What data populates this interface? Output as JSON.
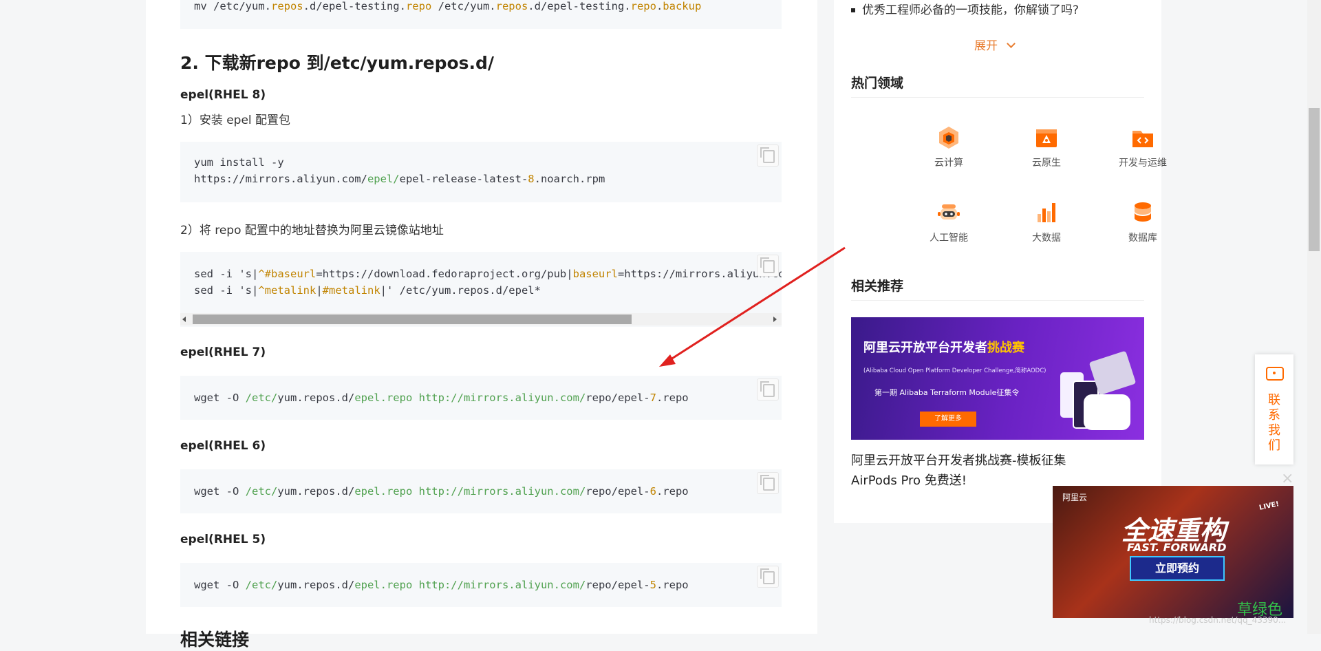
{
  "article": {
    "top_code": {
      "parts": [
        {
          "t": "mv /etc/yum.",
          "c": "c-gray"
        },
        {
          "t": "repos",
          "c": "c-orange"
        },
        {
          "t": ".d/epel-testing.",
          "c": "c-gray"
        },
        {
          "t": "repo",
          "c": "c-orange"
        },
        {
          "t": " /etc/yum.",
          "c": "c-gray"
        },
        {
          "t": "repos",
          "c": "c-orange"
        },
        {
          "t": ".d/epel-testing.",
          "c": "c-gray"
        },
        {
          "t": "repo",
          "c": "c-orange"
        },
        {
          "t": ".",
          "c": "c-gray"
        },
        {
          "t": "backup",
          "c": "c-orange"
        }
      ]
    },
    "section_heading": "2. 下载新repo 到/etc/yum.repos.d/",
    "rhel8": {
      "label": "epel(RHEL 8)",
      "step1": "1）安装 epel 配置包",
      "code_line1": "yum install -y",
      "code_line2_parts": [
        {
          "t": "https://",
          "c": "c-gray"
        },
        {
          "t": "mirrors.aliyun.com/",
          "c": "c-gray"
        },
        {
          "t": "epel/",
          "c": "c-green"
        },
        {
          "t": "epel-release-latest-",
          "c": "c-gray"
        },
        {
          "t": "8",
          "c": "c-orange"
        },
        {
          "t": ".noarch.rpm",
          "c": "c-gray"
        }
      ],
      "step2": "2）将 repo 配置中的地址替换为阿里云镜像站地址",
      "sed_line1_parts": [
        {
          "t": "sed -i 's|",
          "c": "c-gray"
        },
        {
          "t": "^#baseurl",
          "c": "c-orange"
        },
        {
          "t": "=https://download.fedoraproject.org/pub|",
          "c": "c-gray"
        },
        {
          "t": "baseurl",
          "c": "c-orange"
        },
        {
          "t": "=https://mirrors.aliyun.co",
          "c": "c-gray"
        }
      ],
      "sed_line2_parts": [
        {
          "t": "sed -i 's|",
          "c": "c-gray"
        },
        {
          "t": "^metalink",
          "c": "c-orange"
        },
        {
          "t": "|",
          "c": "c-gray"
        },
        {
          "t": "#metalink",
          "c": "c-orange"
        },
        {
          "t": "|' /etc/yum.repos.d/epel*",
          "c": "c-gray"
        }
      ]
    },
    "rhel7": {
      "label": "epel(RHEL 7)",
      "code_parts": [
        {
          "t": "wget -O ",
          "c": "c-gray"
        },
        {
          "t": "/etc/",
          "c": "c-green"
        },
        {
          "t": "yum.repos.d/",
          "c": "c-gray"
        },
        {
          "t": "epel.repo",
          "c": "c-green"
        },
        {
          "t": " http://mirrors.aliyun.com/",
          "c": "c-green"
        },
        {
          "t": "repo/epel-",
          "c": "c-gray"
        },
        {
          "t": "7",
          "c": "c-orange"
        },
        {
          "t": ".repo",
          "c": "c-gray"
        }
      ]
    },
    "rhel6": {
      "label": "epel(RHEL 6)",
      "code_parts": [
        {
          "t": "wget -O ",
          "c": "c-gray"
        },
        {
          "t": "/etc/",
          "c": "c-green"
        },
        {
          "t": "yum.repos.d/",
          "c": "c-gray"
        },
        {
          "t": "epel.repo",
          "c": "c-green"
        },
        {
          "t": " http://mirrors.aliyun.com/",
          "c": "c-green"
        },
        {
          "t": "repo/epel-",
          "c": "c-gray"
        },
        {
          "t": "6",
          "c": "c-orange"
        },
        {
          "t": ".repo",
          "c": "c-gray"
        }
      ]
    },
    "rhel5": {
      "label": "epel(RHEL 5)",
      "code_parts": [
        {
          "t": "wget -O ",
          "c": "c-gray"
        },
        {
          "t": "/etc/",
          "c": "c-green"
        },
        {
          "t": "yum.repos.d/",
          "c": "c-gray"
        },
        {
          "t": "epel.repo",
          "c": "c-green"
        },
        {
          "t": " http://mirrors.aliyun.com/",
          "c": "c-green"
        },
        {
          "t": "repo/epel-",
          "c": "c-gray"
        },
        {
          "t": "5",
          "c": "c-orange"
        },
        {
          "t": ".repo",
          "c": "c-gray"
        }
      ]
    },
    "next_heading_partial": "相关链接"
  },
  "sidebar": {
    "list_item": "优秀工程师必备的一项技能，你解锁了吗?",
    "expand_label": "展开",
    "hot_domains_title": "热门领域",
    "domains": [
      {
        "label": "云计算",
        "icon": "cloud-compute-icon",
        "color": "#ff8a00"
      },
      {
        "label": "云原生",
        "icon": "cloud-native-icon",
        "color": "#ff6a00"
      },
      {
        "label": "开发与运维",
        "icon": "devops-icon",
        "color": "#ff5a1f"
      },
      {
        "label": "人工智能",
        "icon": "ai-robot-icon",
        "color": "#ff6a00"
      },
      {
        "label": "大数据",
        "icon": "big-data-icon",
        "color": "#ff6a00"
      },
      {
        "label": "数据库",
        "icon": "database-icon",
        "color": "#ff6a00"
      }
    ],
    "related_title": "相关推荐",
    "banner": {
      "headline_a": "阿里云开放平台开发者",
      "headline_b": "挑战赛",
      "subline": "(Alibaba Cloud Open Platform Developer Challenge,简称AODC)",
      "issue": "第一期    Alibaba Terraform Module征集令",
      "cta": "了解更多"
    },
    "related_article": "阿里云开放平台开发者挑战赛-模板征集 AirPods Pro 免费送!"
  },
  "float_contact": {
    "label": "联系我们"
  },
  "promo": {
    "brand": "阿里云",
    "headline": "全速重构",
    "subheadline": "FAST. FORWARD",
    "cta": "立即预约",
    "live": "LIVE!",
    "close": "×"
  },
  "watermark": {
    "text": "草绿色",
    "url": "https://blog.csdn.net/qq_43390..."
  },
  "colors": {
    "accent": "#ff6a00",
    "arrow": "#e0211f",
    "link_orange": "#e87b2d"
  }
}
